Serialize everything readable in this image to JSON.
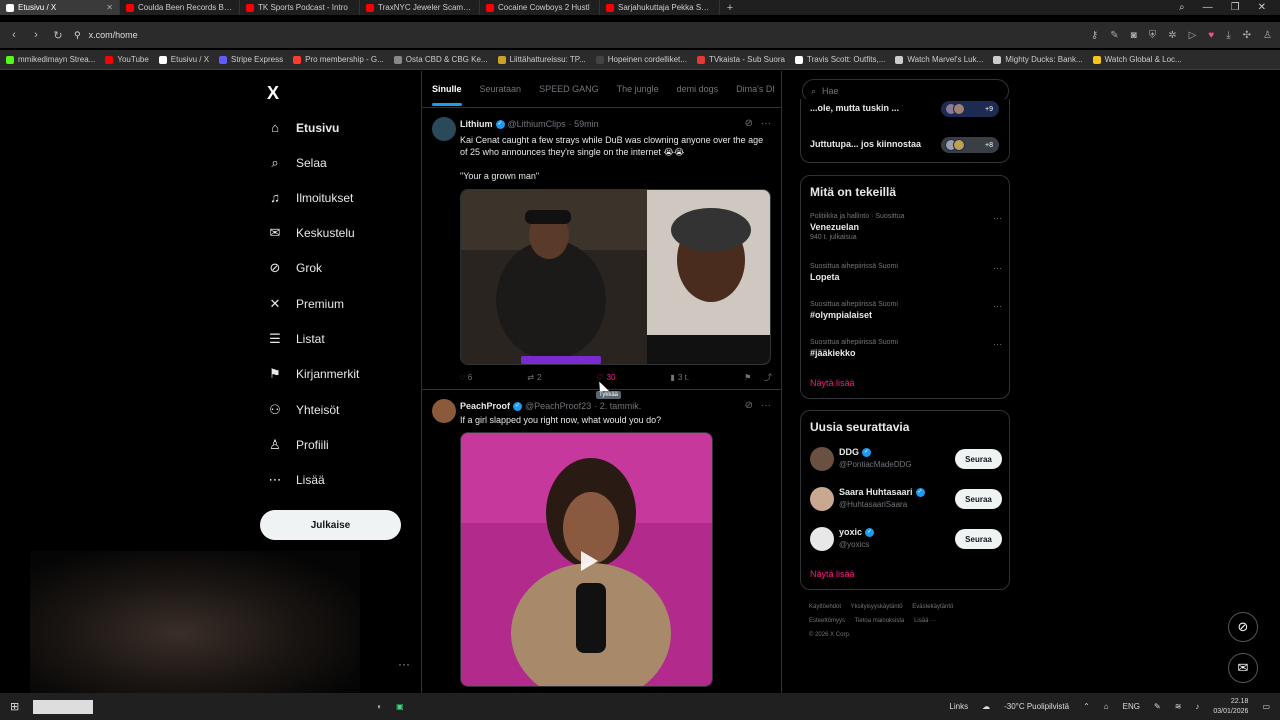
{
  "browser": {
    "tabs": [
      {
        "title": "Etusivu / X",
        "active": true,
        "color": "#ffffff"
      },
      {
        "title": "Coulda Been Records BRO",
        "active": false,
        "color": "#ff0000"
      },
      {
        "title": "TK Sports Podcast - Intro",
        "active": false,
        "color": "#ff0000"
      },
      {
        "title": "TraxNYC Jeweler Scam Sit",
        "active": false,
        "color": "#ff0000"
      },
      {
        "title": "Cocaine Cowboys 2 Hustl",
        "active": false,
        "color": "#ff0000"
      },
      {
        "title": "Sarjahukuttaja Pekka Sepp",
        "active": false,
        "color": "#ff0000"
      }
    ],
    "new_tab": "+",
    "url": "x.com/home",
    "bookmarks": [
      {
        "label": "mmikedimayn Strea...",
        "color": "#53fc18"
      },
      {
        "label": "YouTube",
        "color": "#ff0000"
      },
      {
        "label": "Etusivu / X",
        "color": "#ffffff"
      },
      {
        "label": "Stripe Express",
        "color": "#635bff"
      },
      {
        "label": "Pro membership - G...",
        "color": "#ff3b30"
      },
      {
        "label": "Osta CBD & CBG Ke...",
        "color": "#888888"
      },
      {
        "label": "Liittähattureissu: TP...",
        "color": "#c9a227"
      },
      {
        "label": "Hopeinen cordelliket...",
        "color": "#444444"
      },
      {
        "label": "TVkaista - Sub Suora",
        "color": "#e53935"
      },
      {
        "label": "Travis Scott: Outfits,...",
        "color": "#ffffff"
      },
      {
        "label": "Watch Marvel's Luk...",
        "color": "#cccccc"
      },
      {
        "label": "Mighty Ducks: Bank...",
        "color": "#cccccc"
      },
      {
        "label": "Watch Global & Loc...",
        "color": "#f5c518"
      }
    ]
  },
  "sidebar": {
    "logo": "X",
    "items": [
      {
        "label": "Etusivu",
        "icon": "home-icon",
        "glyph": "⌂",
        "active": true
      },
      {
        "label": "Selaa",
        "icon": "search-icon",
        "glyph": "⌕"
      },
      {
        "label": "Ilmoitukset",
        "icon": "bell-icon",
        "glyph": "♫"
      },
      {
        "label": "Keskustelu",
        "icon": "mail-icon",
        "glyph": "✉"
      },
      {
        "label": "Grok",
        "icon": "grok-icon",
        "glyph": "⊘"
      },
      {
        "label": "Premium",
        "icon": "x-premium-icon",
        "glyph": "✕"
      },
      {
        "label": "Listat",
        "icon": "list-icon",
        "glyph": "☰"
      },
      {
        "label": "Kirjanmerkit",
        "icon": "bookmark-icon",
        "glyph": "⚑"
      },
      {
        "label": "Yhteisöt",
        "icon": "communities-icon",
        "glyph": "⚇"
      },
      {
        "label": "Profiili",
        "icon": "profile-icon",
        "glyph": "♙"
      },
      {
        "label": "Lisää",
        "icon": "more-circle-icon",
        "glyph": "⋯"
      }
    ],
    "post_button": "Julkaise"
  },
  "timeline": {
    "tabs": [
      "Sinulle",
      "Seurataan",
      "SPEED GANG",
      "The jungle",
      "demi dogs",
      "Dima's DI"
    ],
    "tweets": [
      {
        "name": "Lithium",
        "handle": "@LithiumClips",
        "time": "· 59min",
        "text": "Kai Cenat caught a few strays while DuB was clowning anyone over the age of 25 who announces they're single on the internet 😭😭\n\n\"Your a grown man\"",
        "replies": "6",
        "retweets": "2",
        "likes": "30",
        "views": "3 t."
      },
      {
        "name": "PeachProof",
        "handle": "@PeachProof23",
        "time": "· 2. tammik.",
        "text": "If a girl slapped you right now, what would you do?"
      }
    ],
    "tooltip": "Tykkää"
  },
  "right": {
    "search_placeholder": "Hae",
    "top_items": [
      {
        "title": "...ole, mutta tuskin ...",
        "count": "+9"
      },
      {
        "title": "Juttutupa... jos kiinnostaa",
        "count": "+8"
      }
    ],
    "trends_title": "Mitä on tekeillä",
    "trends": [
      {
        "meta": "Politiikka ja hallinto · Suosittua",
        "title": "Venezuelan",
        "count": "940 t. julkaisua"
      },
      {
        "meta": "Suosittua aihepiirissä Suomi",
        "title": "Lopeta",
        "count": ""
      },
      {
        "meta": "Suosittua aihepiirissä Suomi",
        "title": "#olympialaiset",
        "count": ""
      },
      {
        "meta": "Suosittua aihepiirissä Suomi",
        "title": "#jääkiekko",
        "count": ""
      }
    ],
    "show_more": "Näytä lisää",
    "follow_title": "Uusia seurattavia",
    "follows": [
      {
        "name": "DDG",
        "handle": "@PontiacMadeDDG",
        "button": "Seuraa"
      },
      {
        "name": "Saara Huhtasaari",
        "handle": "@HuhtasaariSaara",
        "button": "Seuraa"
      },
      {
        "name": "yoxic",
        "handle": "@yoxics",
        "button": "Seuraa"
      }
    ],
    "footer": [
      "Käyttöehdot",
      "Yksityisyyskäytäntö",
      "Evästekäytäntö",
      "Esteettömyys",
      "Tietoa mainoksista",
      "Lisää ···",
      "© 2026 X Corp."
    ]
  },
  "taskbar": {
    "links": "Links",
    "weather": "-30°C  Puolipilvistä",
    "lang": "ENG",
    "time": "22.18",
    "date": "03/01/2026"
  }
}
